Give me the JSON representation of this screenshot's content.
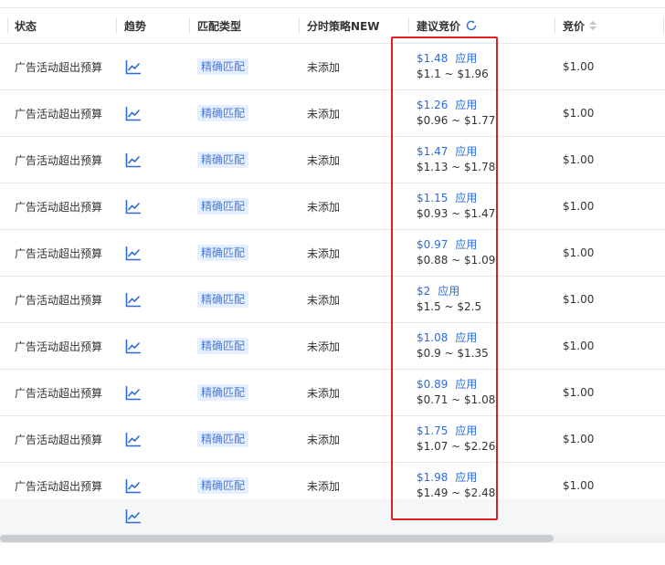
{
  "header": {
    "status": "状态",
    "trend": "趋势",
    "match_type": "匹配类型",
    "strategy": "分时策略NEW",
    "suggested_bid": "建议竞价",
    "bid": "竞价"
  },
  "rows": [
    {
      "status": "广告活动超出预算",
      "match": "精确匹配",
      "strategy": "未添加",
      "suggested": "$1.48",
      "apply": "应用",
      "range": "$1.1 ~ $1.96",
      "bid": "$1.00"
    },
    {
      "status": "广告活动超出预算",
      "match": "精确匹配",
      "strategy": "未添加",
      "suggested": "$1.26",
      "apply": "应用",
      "range": "$0.96 ~ $1.77",
      "bid": "$1.00"
    },
    {
      "status": "广告活动超出预算",
      "match": "精确匹配",
      "strategy": "未添加",
      "suggested": "$1.47",
      "apply": "应用",
      "range": "$1.13 ~ $1.78",
      "bid": "$1.00"
    },
    {
      "status": "广告活动超出预算",
      "match": "精确匹配",
      "strategy": "未添加",
      "suggested": "$1.15",
      "apply": "应用",
      "range": "$0.93 ~ $1.47",
      "bid": "$1.00"
    },
    {
      "status": "广告活动超出预算",
      "match": "精确匹配",
      "strategy": "未添加",
      "suggested": "$0.97",
      "apply": "应用",
      "range": "$0.88 ~ $1.09",
      "bid": "$1.00"
    },
    {
      "status": "广告活动超出预算",
      "match": "精确匹配",
      "strategy": "未添加",
      "suggested": "$2",
      "apply": "应用",
      "range": "$1.5 ~ $2.5",
      "bid": "$1.00"
    },
    {
      "status": "广告活动超出预算",
      "match": "精确匹配",
      "strategy": "未添加",
      "suggested": "$1.08",
      "apply": "应用",
      "range": "$0.9 ~ $1.35",
      "bid": "$1.00"
    },
    {
      "status": "广告活动超出预算",
      "match": "精确匹配",
      "strategy": "未添加",
      "suggested": "$0.89",
      "apply": "应用",
      "range": "$0.71 ~ $1.08",
      "bid": "$1.00"
    },
    {
      "status": "广告活动超出预算",
      "match": "精确匹配",
      "strategy": "未添加",
      "suggested": "$1.75",
      "apply": "应用",
      "range": "$1.07 ~ $2.26",
      "bid": "$1.00"
    },
    {
      "status": "广告活动超出预算",
      "match": "精确匹配",
      "strategy": "未添加",
      "suggested": "$1.98",
      "apply": "应用",
      "range": "$1.49 ~ $2.48",
      "bid": "$1.00"
    }
  ],
  "colors": {
    "link_blue": "#2f6bd6",
    "tag_bg": "#e6efff",
    "highlight_red": "#e02020"
  },
  "icons": {
    "trend": "trend-chart-icon",
    "refresh": "refresh-icon",
    "sort": "sort-icon"
  }
}
